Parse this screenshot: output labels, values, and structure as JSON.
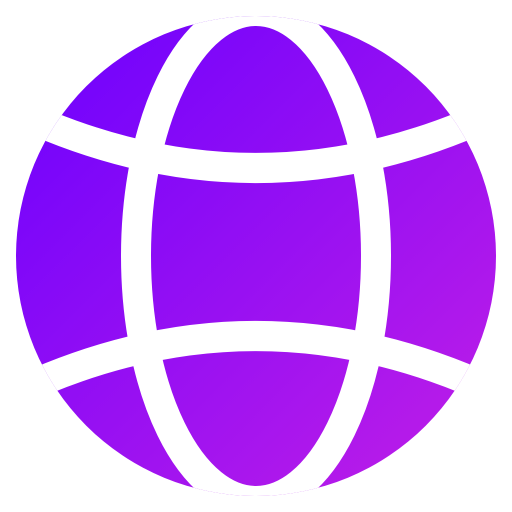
{
  "icon": {
    "name": "globe-icon",
    "colors": {
      "gradient_start": "#6a00ff",
      "gradient_end": "#c21fe6",
      "gap": "#ffffff",
      "background": "#ffffff"
    }
  }
}
